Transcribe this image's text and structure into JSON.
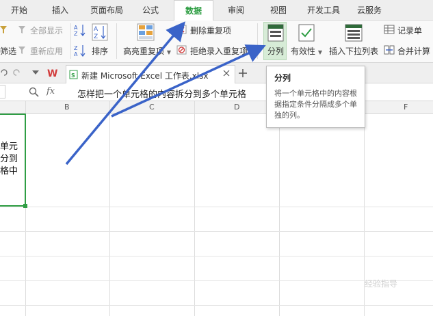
{
  "menu": {
    "tabs": [
      "开始",
      "插入",
      "页面布局",
      "公式",
      "数据",
      "审阅",
      "视图",
      "开发工具",
      "云服务"
    ],
    "active_index": 4
  },
  "ribbon": {
    "filter_partial": "筛选",
    "show_all": "全部显示",
    "reapply": "重新应用",
    "sort": "排序",
    "highlight_duplicates": "高亮重复项",
    "remove_duplicates": "删除重复项",
    "reject_duplicates": "拒绝录入重复项",
    "split": "分列",
    "validity": "有效性",
    "insert_dropdown": "插入下拉列表",
    "record_sheet": "记录单",
    "consolidate": "合并计算"
  },
  "doc_tab": {
    "title": "新建 Microsoft Excel 工作表.xlsx"
  },
  "formula_bar": {
    "fx": "fx",
    "value": "怎样把一个单元格的内容拆分到多个单元格"
  },
  "grid": {
    "columns": [
      "B",
      "C",
      "D",
      "F"
    ],
    "cell_lines": [
      "单元",
      "分到",
      "格中"
    ]
  },
  "tooltip": {
    "title": "分列",
    "description": "将一个单元格中的内容根据指定条件分隔成多个单独的列。"
  },
  "watermark": "经验指导",
  "colors": {
    "accent_green": "#2f9e44",
    "arrow_blue": "#3a63c8"
  }
}
